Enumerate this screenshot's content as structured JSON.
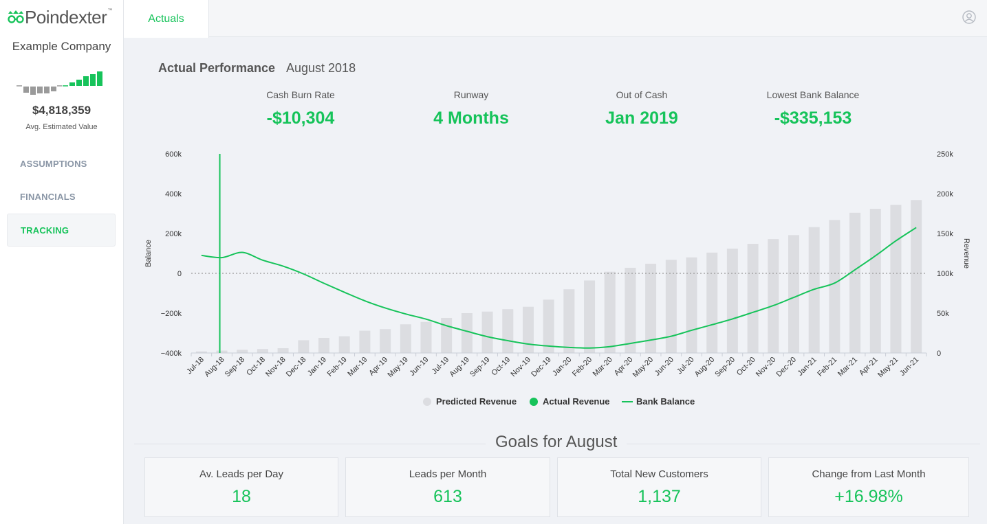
{
  "app": {
    "logo": "Poindexter",
    "logo_tm": "™"
  },
  "sidebar": {
    "company": "Example Company",
    "est_value": "$4,818,359",
    "est_label": "Avg. Estimated Value",
    "nav": [
      {
        "label": "ASSUMPTIONS"
      },
      {
        "label": "FINANCIALS"
      },
      {
        "label": "TRACKING"
      }
    ]
  },
  "topbar": {
    "tab": "Actuals"
  },
  "header": {
    "title": "Actual Performance",
    "date": "August 2018"
  },
  "kpis": [
    {
      "label": "Cash Burn Rate",
      "value": "-$10,304"
    },
    {
      "label": "Runway",
      "value": "4 Months"
    },
    {
      "label": "Out of Cash",
      "value": "Jan 2019"
    },
    {
      "label": "Lowest Bank Balance",
      "value": "-$335,153"
    }
  ],
  "colors": {
    "accent": "#16c35a",
    "bar": "#dcdde1",
    "gray": "#9a9a9a"
  },
  "chart_data": {
    "type": "bar",
    "categories": [
      "Jul-18",
      "Aug-18",
      "Sep-18",
      "Oct-18",
      "Nov-18",
      "Dec-18",
      "Jan-19",
      "Feb-19",
      "Mar-19",
      "Apr-19",
      "May-19",
      "Jun-19",
      "Jul-19",
      "Aug-19",
      "Sep-19",
      "Oct-19",
      "Nov-19",
      "Dec-19",
      "Jan-20",
      "Feb-20",
      "Mar-20",
      "Apr-20",
      "May-20",
      "Jun-20",
      "Jul-20",
      "Aug-20",
      "Sep-20",
      "Oct-20",
      "Nov-20",
      "Dec-20",
      "Jan-21",
      "Feb-21",
      "Mar-21",
      "Apr-21",
      "May-21",
      "Jun-21"
    ],
    "series": [
      {
        "name": "Predicted Revenue",
        "axis": "right",
        "kind": "bar",
        "values": [
          2000,
          3000,
          4000,
          5000,
          6000,
          16000,
          19000,
          21000,
          28000,
          30000,
          36000,
          39000,
          44000,
          50000,
          52000,
          55000,
          58000,
          67000,
          80000,
          91000,
          102000,
          107000,
          112000,
          117000,
          120000,
          126000,
          131000,
          137000,
          143000,
          148000,
          158000,
          167000,
          176000,
          181000,
          186000,
          192000
        ]
      },
      {
        "name": "Actual Revenue",
        "axis": "right",
        "kind": "marker",
        "values": []
      },
      {
        "name": "Bank Balance",
        "axis": "left",
        "kind": "line",
        "values": [
          90000,
          79000,
          105000,
          66000,
          36000,
          -3000,
          -50000,
          -95000,
          -138000,
          -174000,
          -204000,
          -230000,
          -263000,
          -291000,
          -318000,
          -338000,
          -355000,
          -365000,
          -372000,
          -375000,
          -368000,
          -352000,
          -335000,
          -316000,
          -286000,
          -258000,
          -229000,
          -196000,
          -162000,
          -121000,
          -80000,
          -49000,
          18000,
          88000,
          163000,
          230000
        ]
      }
    ],
    "marker": {
      "category": "Aug-18"
    },
    "y_left": {
      "label": "Balance",
      "ticks": [
        "600k",
        "400k",
        "200k",
        "0",
        "−200k",
        "−400k"
      ],
      "range": [
        -400000,
        600000
      ]
    },
    "y_right": {
      "label": "Revenue",
      "ticks": [
        "250k",
        "200k",
        "150k",
        "100k",
        "50k",
        "0"
      ],
      "range": [
        0,
        250000
      ]
    },
    "legend_position": "bottom-center",
    "zero_line": "dotted"
  },
  "goals": {
    "title": "Goals for August",
    "cards": [
      {
        "label": "Av. Leads per Day",
        "value": "18"
      },
      {
        "label": "Leads per Month",
        "value": "613"
      },
      {
        "label": "Total New Customers",
        "value": "1,137"
      },
      {
        "label": "Change from Last Month",
        "value": "+16.98%"
      }
    ]
  }
}
